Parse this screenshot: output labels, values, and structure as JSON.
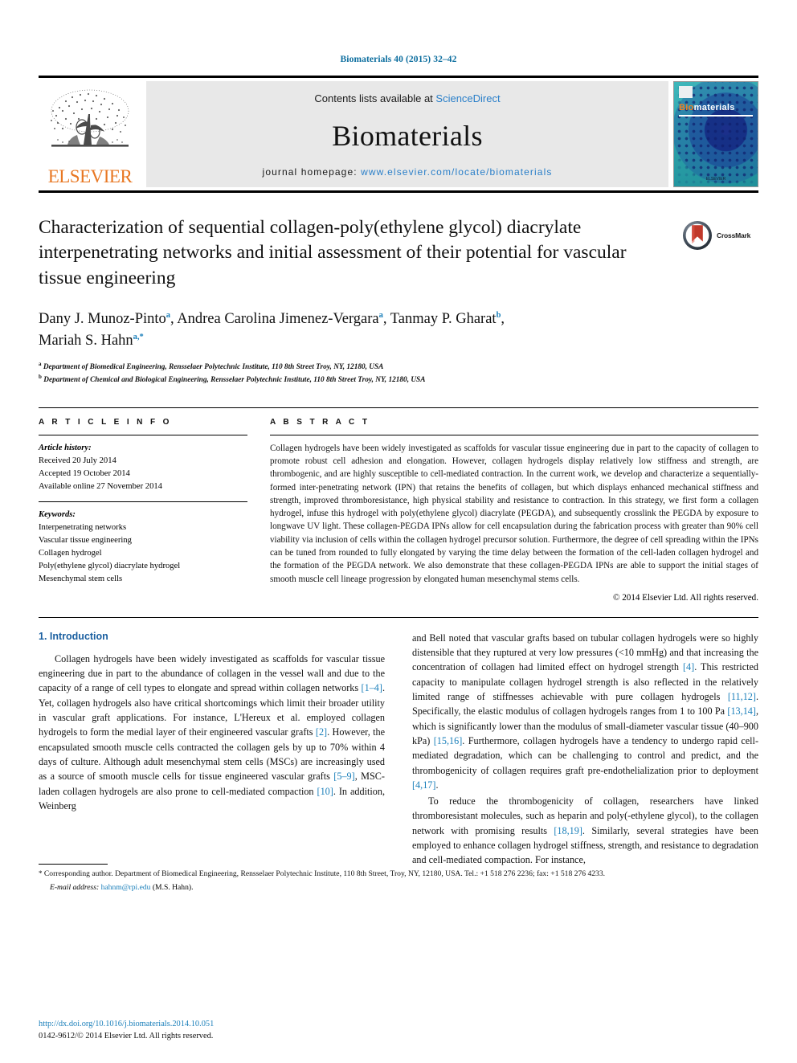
{
  "running_head": "Biomaterials 40 (2015) 32–42",
  "masthead": {
    "publisher_name": "ELSEVIER",
    "contents_prefix": "Contents lists available at ",
    "contents_link": "ScienceDirect",
    "journal_name": "Biomaterials",
    "homepage_prefix": "journal homepage: ",
    "homepage_url": "www.elsevier.com/locate/biomaterials",
    "cover": {
      "title_part1": "Bio",
      "title_part2": "materials",
      "footer": "ELSEVIER"
    }
  },
  "article": {
    "title": "Characterization of sequential collagen-poly(ethylene glycol) diacrylate interpenetrating networks and initial assessment of their potential for vascular tissue engineering",
    "crossmark_label": "CrossMark",
    "authors_line1": "Dany J. Munoz-Pinto",
    "authors_sup1": "a",
    "authors_line1b": ", Andrea Carolina Jimenez-Vergara",
    "authors_sup2": "a",
    "authors_line1c": ", Tanmay P. Gharat",
    "authors_sup3": "b",
    "authors_line2": "Mariah S. Hahn",
    "authors_sup4": "a,",
    "authors_sup5": "*",
    "affiliation_a_sup": "a",
    "affiliation_a": "Department of Biomedical Engineering, Rensselaer Polytechnic Institute, 110 8th Street Troy, NY, 12180, USA",
    "affiliation_b_sup": "b",
    "affiliation_b": "Department of Chemical and Biological Engineering, Rensselaer Polytechnic Institute, 110 8th Street Troy, NY, 12180, USA"
  },
  "article_info": {
    "heading": "A R T I C L E   I N F O",
    "history_label": "Article history:",
    "history": [
      "Received 20 July 2014",
      "Accepted 19 October 2014",
      "Available online 27 November 2014"
    ],
    "keywords_label": "Keywords:",
    "keywords": [
      "Interpenetrating networks",
      "Vascular tissue engineering",
      "Collagen hydrogel",
      "Poly(ethylene glycol) diacrylate hydrogel",
      "Mesenchymal stem cells"
    ]
  },
  "abstract": {
    "heading": "A B S T R A C T",
    "text": "Collagen hydrogels have been widely investigated as scaffolds for vascular tissue engineering due in part to the capacity of collagen to promote robust cell adhesion and elongation. However, collagen hydrogels display relatively low stiffness and strength, are thrombogenic, and are highly susceptible to cell-mediated contraction. In the current work, we develop and characterize a sequentially-formed inter-penetrating network (IPN) that retains the benefits of collagen, but which displays enhanced mechanical stiffness and strength, improved thromboresistance, high physical stability and resistance to contraction. In this strategy, we first form a collagen hydrogel, infuse this hydrogel with poly(ethylene glycol) diacrylate (PEGDA), and subsequently crosslink the PEGDA by exposure to longwave UV light. These collagen-PEGDA IPNs allow for cell encapsulation during the fabrication process with greater than 90% cell viability via inclusion of cells within the collagen hydrogel precursor solution. Furthermore, the degree of cell spreading within the IPNs can be tuned from rounded to fully elongated by varying the time delay between the formation of the cell-laden collagen hydrogel and the formation of the PEGDA network. We also demonstrate that these collagen-PEGDA IPNs are able to support the initial stages of smooth muscle cell lineage progression by elongated human mesenchymal stems cells.",
    "copyright": "© 2014 Elsevier Ltd. All rights reserved."
  },
  "introduction": {
    "section_title": "1. Introduction",
    "left_para1_a": "Collagen hydrogels have been widely investigated as scaffolds for vascular tissue engineering due in part to the abundance of collagen in the vessel wall and due to the capacity of a range of cell types to elongate and spread within collagen networks ",
    "left_ref1": "[1–4]",
    "left_para1_b": ". Yet, collagen hydrogels also have critical shortcomings which limit their broader utility in vascular graft applications. For instance, L'Hereux et al. employed collagen hydrogels to form the medial layer of their engineered vascular grafts ",
    "left_ref2": "[2]",
    "left_para1_c": ". However, the encapsulated smooth muscle cells contracted the collagen gels by up to 70% within 4 days of culture. Although adult mesenchymal stem cells (MSCs) are increasingly used as a source of smooth muscle cells for tissue engineered vascular grafts ",
    "left_ref3": "[5–9]",
    "left_para1_d": ", MSC-laden collagen hydrogels are also prone to cell-mediated compaction ",
    "left_ref4": "[10]",
    "left_para1_e": ". In addition, Weinberg",
    "right_para1_a": "and Bell noted that vascular grafts based on tubular collagen hydrogels were so highly distensible that they ruptured at very low pressures (<10 mmHg) and that increasing the concentration of collagen had limited effect on hydrogel strength ",
    "right_ref1": "[4]",
    "right_para1_b": ". This restricted capacity to manipulate collagen hydrogel strength is also reflected in the relatively limited range of stiffnesses achievable with pure collagen hydrogels ",
    "right_ref2": "[11,12]",
    "right_para1_c": ". Specifically, the elastic modulus of collagen hydrogels ranges from 1 to 100 Pa ",
    "right_ref3": "[13,14]",
    "right_para1_d": ", which is significantly lower than the modulus of small-diameter vascular tissue (40–900 kPa) ",
    "right_ref4": "[15,16]",
    "right_para1_e": ". Furthermore, collagen hydrogels have a tendency to undergo rapid cell-mediated degradation, which can be challenging to control and predict, and the thrombogenicity of collagen requires graft pre-endothelialization prior to deployment ",
    "right_ref5": "[4,17]",
    "right_para1_f": ".",
    "right_para2_a": "To reduce the thrombogenicity of collagen, researchers have linked thromboresistant molecules, such as heparin and poly(-ethylene glycol), to the collagen network with promising results ",
    "right_ref6": "[18,19]",
    "right_para2_b": ". Similarly, several strategies have been employed to enhance collagen hydrogel stiffness, strength, and resistance to degradation and cell-mediated compaction. For instance,"
  },
  "footnotes": {
    "corresponding_star": "*",
    "corresponding": " Corresponding author. Department of Biomedical Engineering, Rensselaer Polytechnic Institute, 110 8th Street, Troy, NY, 12180, USA. Tel.: +1 518 276 2236; fax: +1 518 276 4233.",
    "email_label": "E-mail address:",
    "email": "hahnm@rpi.edu",
    "email_suffix": " (M.S. Hahn)."
  },
  "footer": {
    "doi": "http://dx.doi.org/10.1016/j.biomaterials.2014.10.051",
    "issn": "0142-9612/© 2014 Elsevier Ltd. All rights reserved."
  },
  "colors": {
    "link_blue": "#1a7fba",
    "elsevier_orange": "#E87722",
    "section_blue": "#1a5fa0",
    "masthead_gray": "#e8e8e8"
  }
}
